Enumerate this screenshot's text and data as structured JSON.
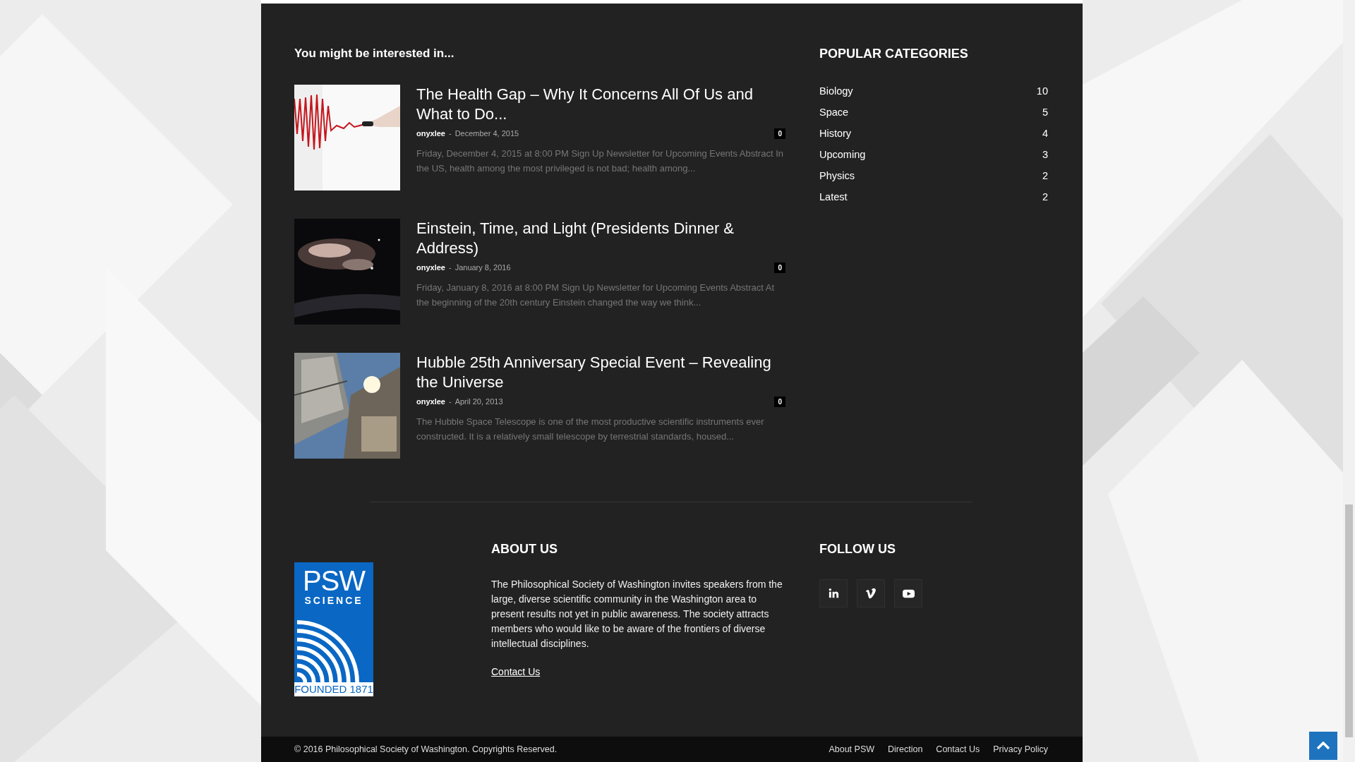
{
  "related": {
    "heading": "You might be interested in...",
    "articles": [
      {
        "kind": "heart",
        "title": "The Health Gap – Why It Concerns All Of Us and What to Do...",
        "author": "onyxlee",
        "separator": "-",
        "date": "December 4, 2015",
        "comments": "0",
        "excerpt": "Friday, December 4, 2015 at 8:00 PM Sign Up Newsletter for Upcoming Events Abstract In the US, health among the most privileged is not bad; health among..."
      },
      {
        "kind": "nebula",
        "title": "Einstein, Time, and Light (Presidents Dinner & Address)",
        "author": "onyxlee",
        "separator": "-",
        "date": "January 8, 2016",
        "comments": "0",
        "excerpt": "Friday, January 8, 2016 at 8:00 PM Sign Up Newsletter for Upcoming Events Abstract At the beginning of the 20th century Einstein changed the way we think..."
      },
      {
        "kind": "telescope",
        "title": "Hubble 25th Anniversary Special Event – Revealing the Universe",
        "author": "onyxlee",
        "separator": "-",
        "date": "April 20, 2013",
        "comments": "0",
        "excerpt": "The Hubble Space Telescope is one of the most productive scientific instruments ever constructed. It is a relatively small telescope by terrestrial standards, housed..."
      }
    ]
  },
  "categories": {
    "heading": "POPULAR CATEGORIES",
    "items": [
      {
        "name": "Biology",
        "count": "10"
      },
      {
        "name": "Space",
        "count": "5"
      },
      {
        "name": "History",
        "count": "4"
      },
      {
        "name": "Upcoming",
        "count": "3"
      },
      {
        "name": "Physics",
        "count": "2"
      },
      {
        "name": "Latest",
        "count": "2"
      }
    ]
  },
  "logo": {
    "title": "PSW",
    "subtitle": "SCIENCE",
    "founded": "FOUNDED 1871"
  },
  "about": {
    "heading": "ABOUT US",
    "text": "The Philosophical Society of Washington invites speakers from the large, diverse scientific community in the Washington area to present results not yet in public awareness. The society attracts members who would like to be aware of the frontiers of diverse intellectual disciplines.",
    "link": "Contact Us"
  },
  "follow": {
    "heading": "FOLLOW US",
    "networks": [
      {
        "kind": "linkedin"
      },
      {
        "kind": "vimeo"
      },
      {
        "kind": "youtube"
      }
    ]
  },
  "bottom_bar": {
    "copyright": "© 2016 Philosophical Society of Washington. Copyrights Reserved.",
    "links": [
      "About PSW",
      "Direction",
      "Contact Us",
      "Privacy Policy"
    ]
  }
}
